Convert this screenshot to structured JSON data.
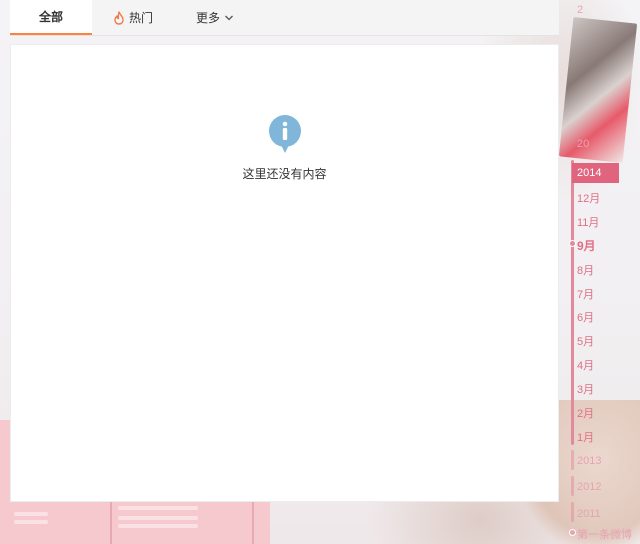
{
  "tabs": {
    "all": "全部",
    "hot": "热门",
    "more": "更多"
  },
  "empty_state": {
    "message": "这里还没有内容",
    "icon": "info-icon"
  },
  "timeline": {
    "top_partial": "2",
    "obscured_year": "20",
    "active_year": "2014",
    "months": [
      "12月",
      "11月",
      "9月",
      "8月",
      "7月",
      "6月",
      "5月",
      "4月",
      "3月",
      "2月",
      "1月"
    ],
    "current_month": "9月",
    "years": [
      "2013",
      "2012",
      "2011"
    ],
    "first_post": "第一条微博"
  },
  "colors": {
    "accent_orange": "#ff8140",
    "timeline_pink": "#e0647e",
    "info_blue": "#7fb6d9"
  }
}
